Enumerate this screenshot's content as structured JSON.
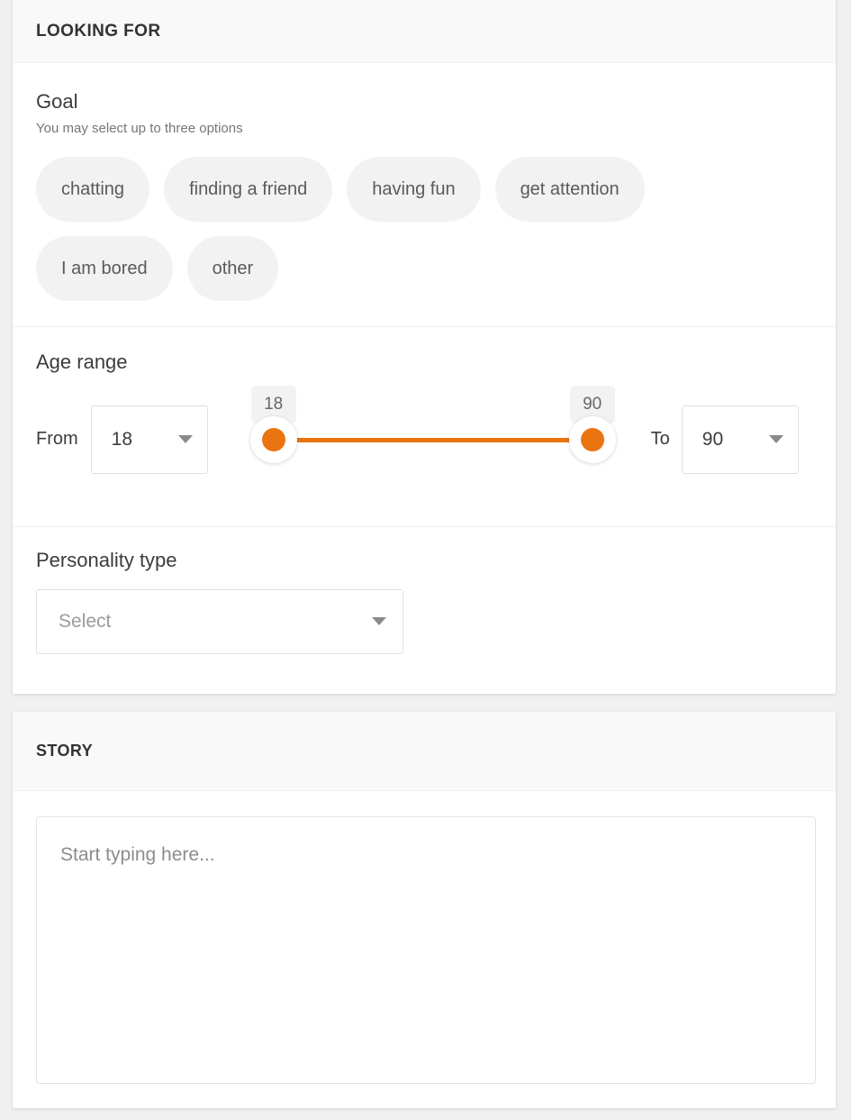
{
  "looking_for": {
    "title": "LOOKING FOR",
    "goal": {
      "label": "Goal",
      "hint": "You may select up to three options",
      "options": [
        "chatting",
        "finding a friend",
        "having fun",
        "get attention",
        "I am bored",
        "other"
      ]
    },
    "age_range": {
      "label": "Age range",
      "from_label": "From",
      "to_label": "To",
      "from_value": "18",
      "to_value": "90",
      "slider_min_tooltip": "18",
      "slider_max_tooltip": "90",
      "track_color": "#ea7410"
    },
    "personality": {
      "label": "Personality type",
      "placeholder": "Select"
    }
  },
  "story": {
    "title": "STORY",
    "placeholder": "Start typing here...",
    "value": ""
  }
}
